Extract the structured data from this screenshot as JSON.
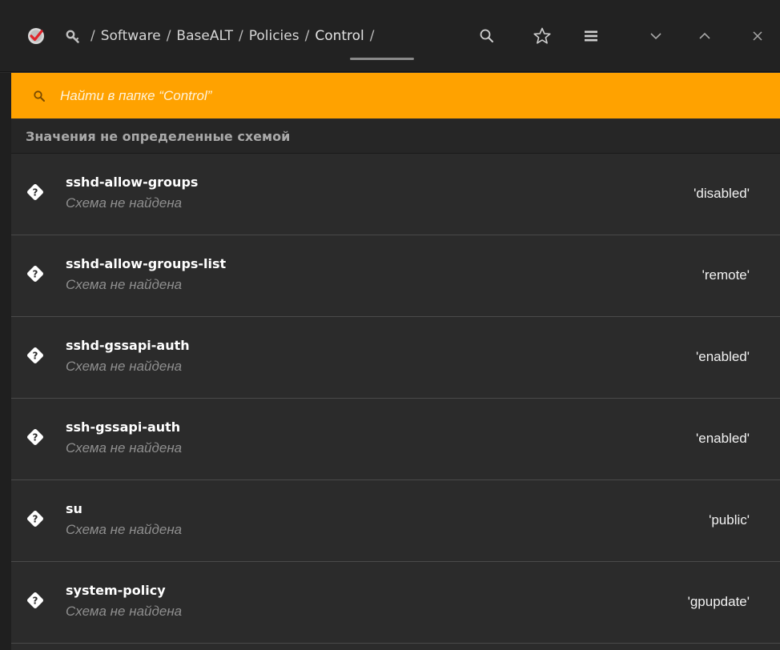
{
  "header": {
    "app_icon": "red-checkmark-icon",
    "root_icon": "key-icon",
    "breadcrumbs": [
      "Software",
      "BaseALT",
      "Policies",
      "Control"
    ],
    "separator": "/",
    "buttons": [
      "search-icon",
      "star-icon",
      "menu-icon",
      "chevron-down-icon",
      "chevron-up-icon",
      "close-icon"
    ]
  },
  "search": {
    "placeholder": "Найти в папке “Control”",
    "value": ""
  },
  "section": {
    "title": "Значения не определенные схемой"
  },
  "rows": [
    {
      "name": "sshd-allow-groups",
      "subtitle": "Схема не найдена",
      "value": "'disabled'"
    },
    {
      "name": "sshd-allow-groups-list",
      "subtitle": "Схема не найдена",
      "value": "'remote'"
    },
    {
      "name": "sshd-gssapi-auth",
      "subtitle": "Схема не найдена",
      "value": "'enabled'"
    },
    {
      "name": "ssh-gssapi-auth",
      "subtitle": "Схема не найдена",
      "value": "'enabled'"
    },
    {
      "name": "su",
      "subtitle": "Схема не найдена",
      "value": "'public'"
    },
    {
      "name": "system-policy",
      "subtitle": "Схема не найдена",
      "value": "'gpupdate'"
    }
  ],
  "colors": {
    "accent": "#ffa200",
    "background": "#2b2b2b",
    "header": "#222222"
  }
}
